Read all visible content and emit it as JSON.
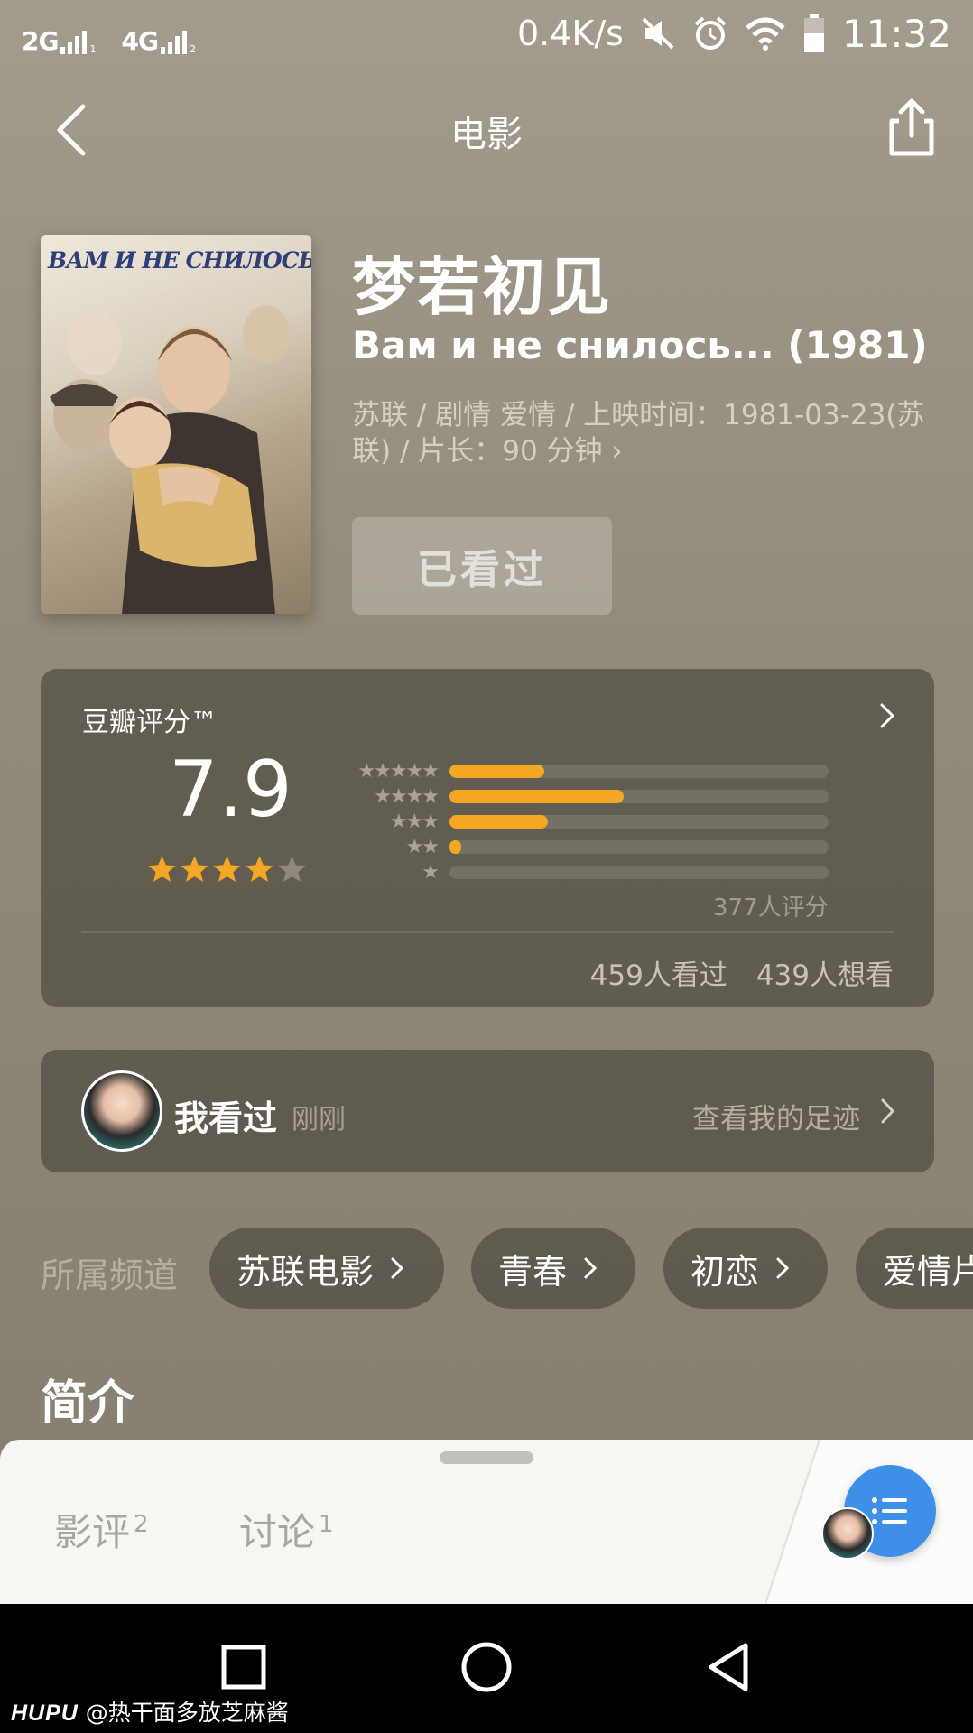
{
  "status_bar": {
    "net1": "2G",
    "net1_sub": "1",
    "net2": "4G",
    "net2_sub": "2",
    "speed": "0.4K/s",
    "time": "11:32"
  },
  "header": {
    "title": "电影"
  },
  "poster": {
    "caption": "ВАМ И НЕ СНИЛОСЬ..."
  },
  "movie": {
    "title_zh": "梦若初见",
    "title_original": "Вам и не снилось... (1981)",
    "meta": "苏联 / 剧情 爱情 / 上映时间：1981-03-23(苏联) / 片长：90 分钟 ›",
    "watched_button": "已看过"
  },
  "rating": {
    "label": "豆瓣评分™",
    "score": "7.9",
    "stars": 4,
    "distribution": [
      {
        "stars": 5,
        "fraction": 0.25
      },
      {
        "stars": 4,
        "fraction": 0.46
      },
      {
        "stars": 3,
        "fraction": 0.26
      },
      {
        "stars": 2,
        "fraction": 0.03
      },
      {
        "stars": 1,
        "fraction": 0.0
      }
    ],
    "count_text": "377人评分",
    "watched_text": "459人看过",
    "wish_text": "439人想看",
    "accent_color": "#f5a623"
  },
  "my_record": {
    "label": "我看过",
    "time": "刚刚",
    "link": "查看我的足迹"
  },
  "channels": {
    "label": "所属频道",
    "items": [
      "苏联电影",
      "青春",
      "初恋",
      "爱情片"
    ]
  },
  "section": {
    "intro_title": "简介"
  },
  "sheet": {
    "tabs": [
      {
        "label": "影评",
        "count": "2"
      },
      {
        "label": "讨论",
        "count": "1"
      }
    ],
    "fab_color": "#3d8fe8"
  },
  "watermark": {
    "brand": "HUPU",
    "text": "@热干面多放芝麻酱"
  }
}
